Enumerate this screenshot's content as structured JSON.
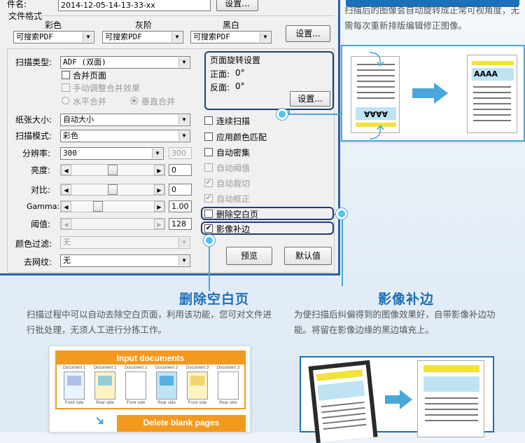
{
  "dialog": {
    "file_name_label": "件名:",
    "file_name_value": "2014-12-05-14-13-33-xx",
    "file_name_setting_button": "设置...",
    "file_format_label": "文件格式",
    "color_modes": [
      {
        "label": "彩色",
        "value": "可搜索PDF"
      },
      {
        "label": "灰阶",
        "value": "可搜索PDF"
      },
      {
        "label": "黑白",
        "value": "可搜索PDF"
      }
    ],
    "format_setting_button": "设置...",
    "scan_type_label": "扫描类型:",
    "scan_type_value": "ADF (双面)",
    "merge_pages_label": "合并页面",
    "manual_merge_label": "手动调整合并效果",
    "horizontal_merge_label": "水平合并",
    "vertical_merge_label": "垂直合并",
    "rotation": {
      "title": "页面旋转设置",
      "front_label": "正面:",
      "front_value": "0°",
      "back_label": "反面:",
      "back_value": "0°",
      "setting_button": "设置..."
    },
    "paper_size_label": "纸张大小:",
    "paper_size_value": "自动大小",
    "scan_mode_label": "扫描模式:",
    "scan_mode_value": "彩色",
    "resolution_label": "分辨率:",
    "resolution_value": "300",
    "resolution_text": "300",
    "brightness_label": "亮度:",
    "brightness_value": "0",
    "brightness_level": 0.5,
    "contrast_label": "对比:",
    "contrast_value": "0",
    "contrast_level": 0.5,
    "gamma_label": "Gamma:",
    "gamma_value": "1.00",
    "gamma_level": 0.3,
    "threshold_label": "阈值:",
    "threshold_value": "128",
    "threshold_level": 0.5,
    "color_filter_label": "颜色过滤:",
    "color_filter_value": "无",
    "descreen_label": "去网纹:",
    "descreen_value": "无",
    "options": [
      {
        "label": "连续扫描",
        "checked": false,
        "disabled": false
      },
      {
        "label": "应用颜色匹配",
        "checked": false,
        "disabled": false
      },
      {
        "label": "自动密集",
        "checked": false,
        "disabled": false
      },
      {
        "label": "自动阈值",
        "checked": false,
        "disabled": true
      },
      {
        "label": "自动裁切",
        "checked": true,
        "disabled": true
      },
      {
        "label": "自动框正",
        "checked": true,
        "disabled": true
      },
      {
        "label": "删除空白页",
        "checked": false,
        "disabled": false
      },
      {
        "label": "影像补边",
        "checked": true,
        "disabled": false
      }
    ],
    "preview_button": "预览",
    "default_button": "默认值"
  },
  "rotate_feature": {
    "description": "扫描后的图像会自动旋转成正常可视角度，无需每次重新排版编辑修正图像。",
    "sample_text_rotated": "AAAA",
    "sample_text_fixed": "AAAA"
  },
  "blank_page_feature": {
    "title": "删除空白页",
    "description": "扫描过程中可以自动去除空白页面，利用该功能，您可对文件进行批处理，无须人工进行分拣工作。",
    "input_header": "Input documents",
    "documents": [
      {
        "name": "Document 1",
        "side": "Front side"
      },
      {
        "name": "Document 1",
        "side": "Rear side"
      },
      {
        "name": "Document 2",
        "side": "Front side"
      },
      {
        "name": "Document 2",
        "side": "Rear side"
      },
      {
        "name": "Document 3",
        "side": "Front side"
      },
      {
        "name": "Document 3",
        "side": "Rear side"
      }
    ],
    "delete_header": "Delete blank pages"
  },
  "border_feature": {
    "title": "影像补边",
    "description": "为使扫描后纠偏得到的图像效果好，自带影像补边功能。将留在影像边缘的黑边填充上。"
  },
  "colors": {
    "accent_blue": "#1d6fb8",
    "highlight_dark": "#1f3f73",
    "dot_cyan": "#4fc3f7",
    "orange": "#f39a1e",
    "yellow": "#f2e23a",
    "light_blue": "#bfe3f5"
  }
}
